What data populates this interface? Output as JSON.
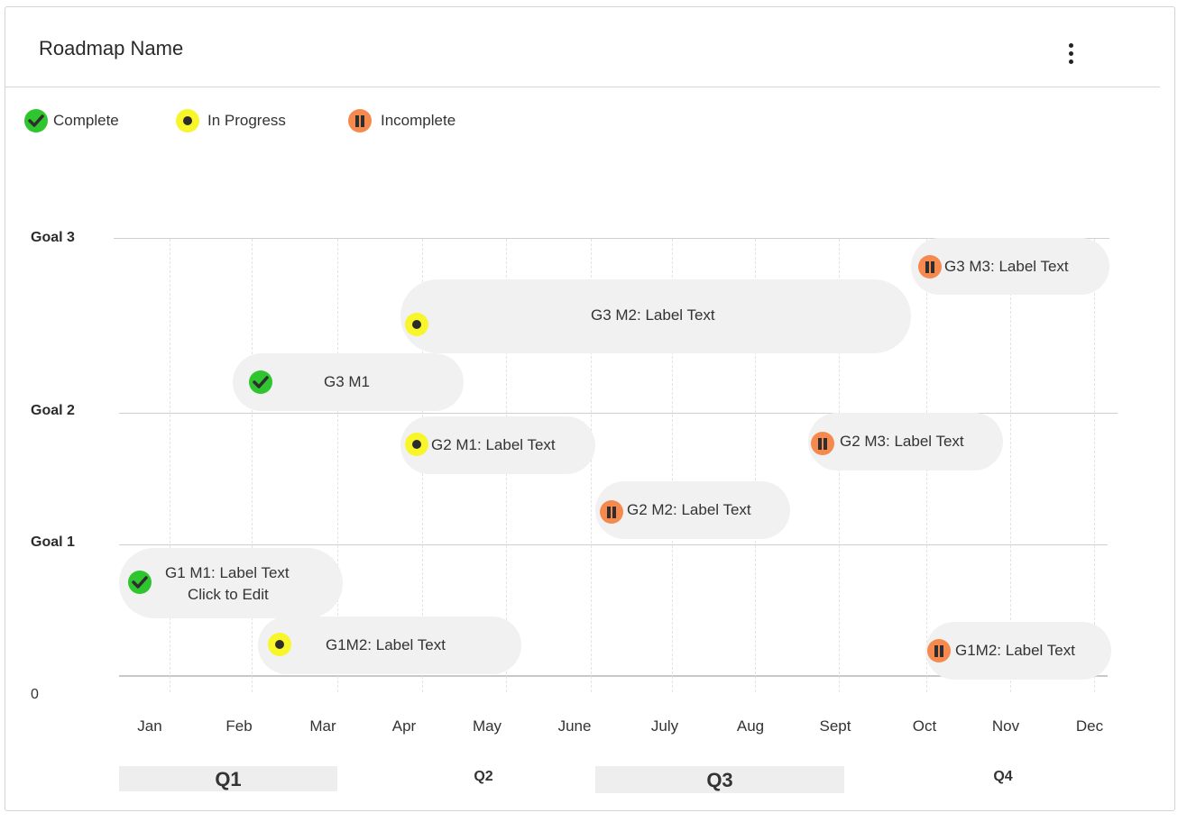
{
  "header": {
    "title": "Roadmap Name",
    "menu_icon": "more-vertical-icon"
  },
  "legend": {
    "complete": "Complete",
    "in_progress": "In Progress",
    "incomplete": "Incomplete"
  },
  "axis": {
    "goals": [
      "Goal 3",
      "Goal 2",
      "Goal 1"
    ],
    "zero": "0",
    "months": [
      "Jan",
      "Feb",
      "Mar",
      "Apr",
      "May",
      "June",
      "July",
      "Aug",
      "Sept",
      "Oct",
      "Nov",
      "Dec"
    ],
    "quarters": [
      "Q1",
      "Q2",
      "Q3",
      "Q4"
    ]
  },
  "milestones": {
    "g3m3": {
      "label": "G3 M3: Label Text",
      "status": "incomplete"
    },
    "g3m2": {
      "label": "G3 M2: Label Text",
      "status": "in-progress"
    },
    "g3m1": {
      "label": "G3 M1",
      "status": "complete"
    },
    "g2m1": {
      "label": "G2 M1: Label Text",
      "status": "in-progress"
    },
    "g2m3": {
      "label": "G2 M3: Label Text",
      "status": "incomplete"
    },
    "g2m2": {
      "label": "G2 M2: Label Text",
      "status": "incomplete"
    },
    "g1m1": {
      "label": "G1 M1: Label Text",
      "sublabel": "Click to Edit",
      "status": "complete"
    },
    "g1m2a": {
      "label": "G1M2: Label Text",
      "status": "in-progress"
    },
    "g1m2b": {
      "label": "G1M2: Label Text",
      "status": "incomplete"
    }
  },
  "colors": {
    "complete": "#2fc52f",
    "in_progress": "#f8f62a",
    "incomplete": "#f6894e",
    "pill_background": "#f1f1f1"
  }
}
